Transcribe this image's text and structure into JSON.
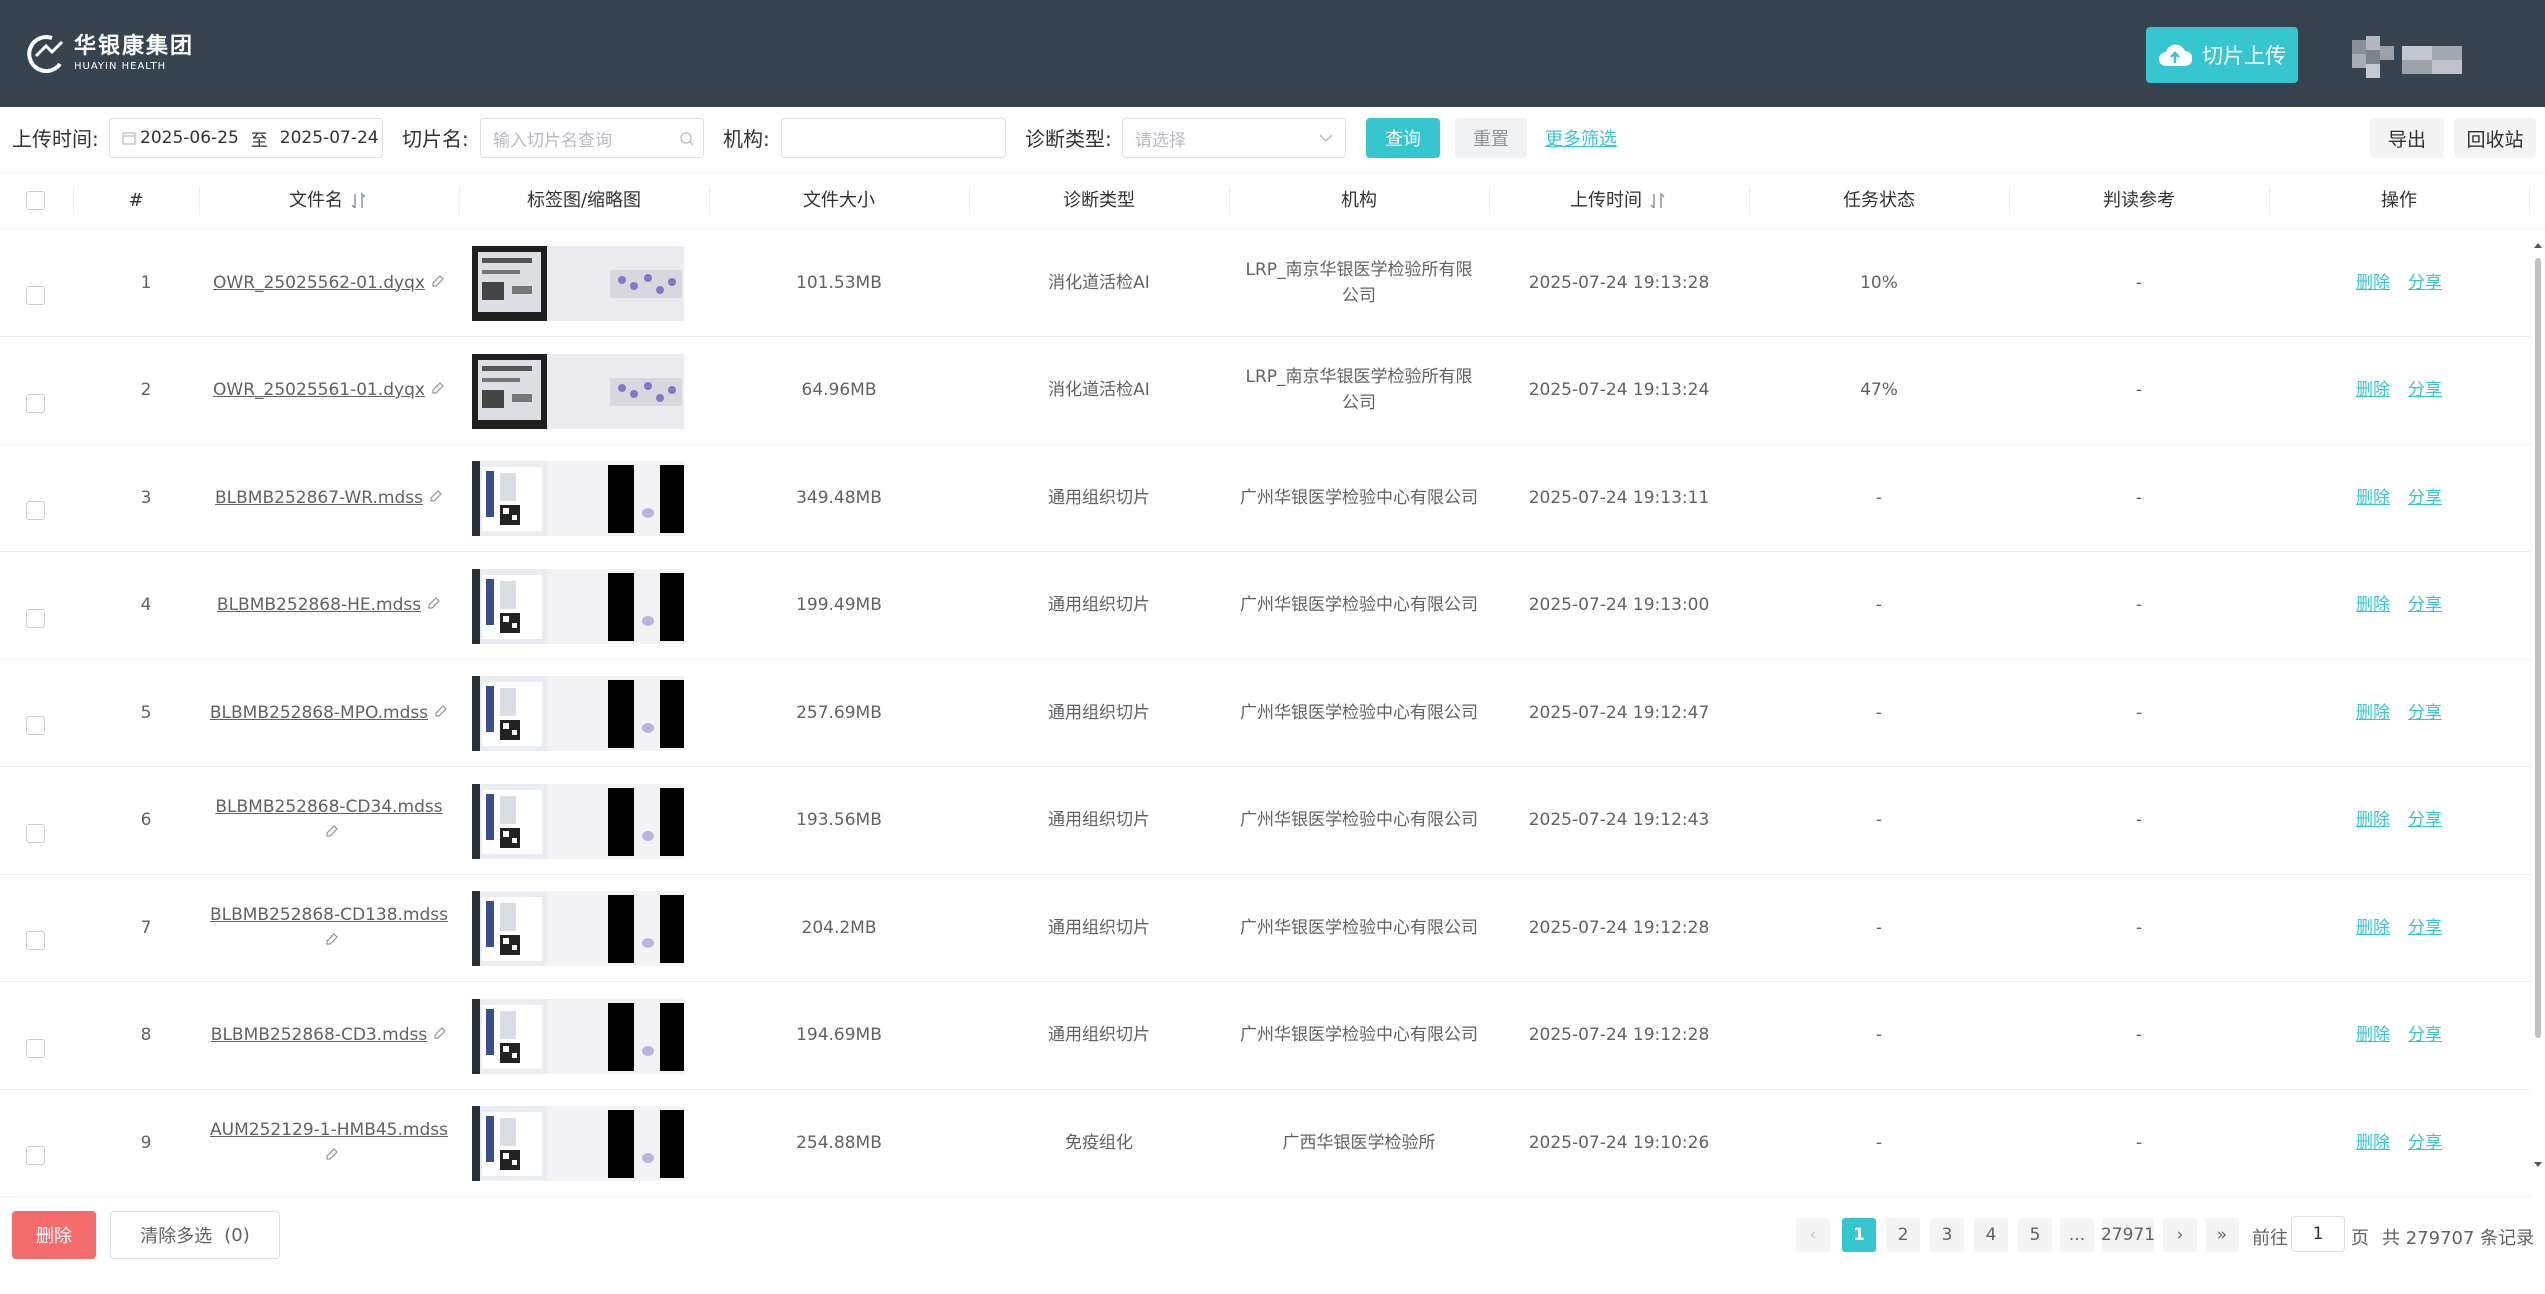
{
  "header": {
    "logo_cn": "华银康集团",
    "logo_en": "HUAYIN HEALTH",
    "upload_label": "切片上传"
  },
  "filters": {
    "upload_time_label": "上传时间:",
    "date_start": "2025-06-25",
    "date_sep": "至",
    "date_end": "2025-07-24",
    "slide_name_label": "切片名:",
    "slide_name_placeholder": "输入切片名查询",
    "org_label": "机构:",
    "org_value": "",
    "diag_type_label": "诊断类型:",
    "diag_type_placeholder": "请选择",
    "query_label": "查询",
    "reset_label": "重置",
    "more_filters_label": "更多筛选",
    "export_label": "导出",
    "recycle_label": "回收站"
  },
  "table": {
    "columns": {
      "index": "#",
      "file_name": "文件名",
      "thumbnail": "标签图/缩略图",
      "file_size": "文件大小",
      "diag_type": "诊断类型",
      "org": "机构",
      "upload_time": "上传时间",
      "task_status": "任务状态",
      "reading_ref": "判读参考",
      "actions": "操作"
    },
    "delete_label": "删除",
    "share_label": "分享",
    "rows": [
      {
        "index": "1",
        "file_name": "OWR_25025562-01.dyqx",
        "file_size": "101.53MB",
        "diag_type": "消化道活检AI",
        "org": "LRP_南京华银医学检验所有限公司",
        "upload_time": "2025-07-24 19:13:28",
        "task_status": "10%",
        "reading_ref": "-",
        "thumb_type": "dark"
      },
      {
        "index": "2",
        "file_name": "OWR_25025561-01.dyqx",
        "file_size": "64.96MB",
        "diag_type": "消化道活检AI",
        "org": "LRP_南京华银医学检验所有限公司",
        "upload_time": "2025-07-24 19:13:24",
        "task_status": "47%",
        "reading_ref": "-",
        "thumb_type": "dark"
      },
      {
        "index": "3",
        "file_name": "BLBMB252867-WR.mdss",
        "file_size": "349.48MB",
        "diag_type": "通用组织切片",
        "org": "广州华银医学检验中心有限公司",
        "upload_time": "2025-07-24 19:13:11",
        "task_status": "-",
        "reading_ref": "-",
        "thumb_type": "bw"
      },
      {
        "index": "4",
        "file_name": "BLBMB252868-HE.mdss",
        "file_size": "199.49MB",
        "diag_type": "通用组织切片",
        "org": "广州华银医学检验中心有限公司",
        "upload_time": "2025-07-24 19:13:00",
        "task_status": "-",
        "reading_ref": "-",
        "thumb_type": "bw"
      },
      {
        "index": "5",
        "file_name": "BLBMB252868-MPO.mdss",
        "file_size": "257.69MB",
        "diag_type": "通用组织切片",
        "org": "广州华银医学检验中心有限公司",
        "upload_time": "2025-07-24 19:12:47",
        "task_status": "-",
        "reading_ref": "-",
        "thumb_type": "bw"
      },
      {
        "index": "6",
        "file_name": "BLBMB252868-CD34.mdss",
        "file_size": "193.56MB",
        "diag_type": "通用组织切片",
        "org": "广州华银医学检验中心有限公司",
        "upload_time": "2025-07-24 19:12:43",
        "task_status": "-",
        "reading_ref": "-",
        "thumb_type": "bw"
      },
      {
        "index": "7",
        "file_name": "BLBMB252868-CD138.mdss",
        "file_size": "204.2MB",
        "diag_type": "通用组织切片",
        "org": "广州华银医学检验中心有限公司",
        "upload_time": "2025-07-24 19:12:28",
        "task_status": "-",
        "reading_ref": "-",
        "thumb_type": "bw"
      },
      {
        "index": "8",
        "file_name": "BLBMB252868-CD3.mdss",
        "file_size": "194.69MB",
        "diag_type": "通用组织切片",
        "org": "广州华银医学检验中心有限公司",
        "upload_time": "2025-07-24 19:12:28",
        "task_status": "-",
        "reading_ref": "-",
        "thumb_type": "bw"
      },
      {
        "index": "9",
        "file_name": "AUM252129-1-HMB45.mdss",
        "file_size": "254.88MB",
        "diag_type": "免疫组化",
        "org": "广西华银医学检验所",
        "upload_time": "2025-07-24 19:10:26",
        "task_status": "-",
        "reading_ref": "-",
        "thumb_type": "bw"
      }
    ]
  },
  "footer": {
    "delete_label": "删除",
    "clear_selection_label": "清除多选",
    "selected_count": "(0)",
    "pages": [
      "1",
      "2",
      "3",
      "4",
      "5"
    ],
    "ellipsis": "...",
    "last_page": "27971",
    "goto_label": "前往",
    "goto_value": "1",
    "page_unit": "页",
    "total_label": "共 279707 条记录"
  },
  "colors": {
    "header_bg": "#37434f",
    "accent": "#36c6cf",
    "danger": "#f56c6c"
  }
}
